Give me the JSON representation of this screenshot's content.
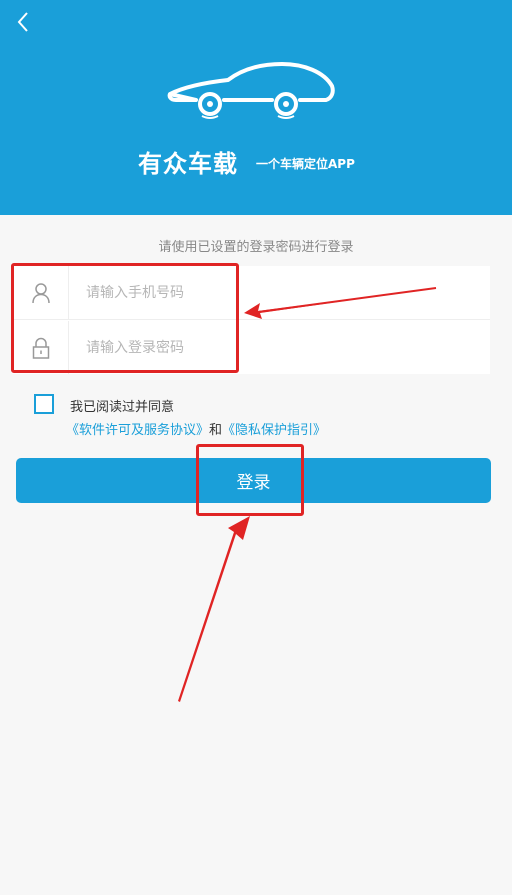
{
  "header": {
    "back_icon": "chevron-left-icon",
    "logo_icon": "car-icon",
    "brand_name": "有众车载",
    "brand_slogan": "一个车辆定位APP",
    "background_color": "#1a9fd9"
  },
  "login": {
    "hint": "请使用已设置的登录密码进行登录",
    "phone_field": {
      "icon": "user-icon",
      "placeholder": "请输入手机号码",
      "value": ""
    },
    "password_field": {
      "icon": "lock-icon",
      "placeholder": "请输入登录密码",
      "value": ""
    },
    "agreement": {
      "checked": false,
      "text": "我已阅读过并同意",
      "license_link": "《软件许可及服务协议》",
      "connector": "和",
      "privacy_link": "《隐私保护指引》"
    },
    "submit_label": "登录"
  },
  "annotations": {
    "color": "#e02424"
  }
}
